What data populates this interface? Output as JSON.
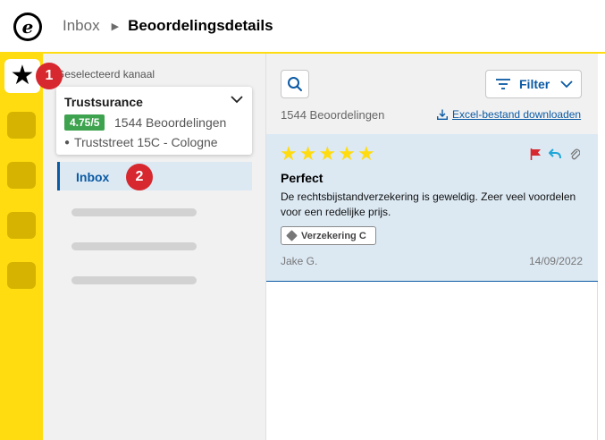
{
  "header": {
    "logo_letter": "e",
    "breadcrumb_parent": "Inbox",
    "breadcrumb_current": "Beoordelingsdetails"
  },
  "rail": {
    "active_icon": "star-icon",
    "badge_one": "1"
  },
  "sidebar": {
    "selected_label": "Geselecteerd kanaal",
    "channel": {
      "name": "Trustsurance",
      "rating": "4.75/5",
      "review_count": "1544 Beoordelingen",
      "address": "Truststreet 15C - Cologne"
    },
    "inbox_label": "Inbox",
    "badge_two": "2"
  },
  "toolbar": {
    "filter_label": "Filter",
    "count_text": "1544 Beoordelingen",
    "download_label": "Excel-bestand downloaden"
  },
  "review": {
    "stars": 5,
    "title": "Perfect",
    "body": "De rechtsbijstandverzekering is geweldig. Zeer veel voordelen voor een redelijke prijs.",
    "tag": "Verzekering C",
    "author": "Jake G.",
    "date": "14/09/2022"
  },
  "colors": {
    "brand_yellow": "#ffdc0f",
    "primary_blue": "#0b5aa4",
    "badge_red": "#d7282f",
    "rating_green": "#3ea34f",
    "flag_red": "#d7282f",
    "reply_blue": "#1fa6d8"
  }
}
